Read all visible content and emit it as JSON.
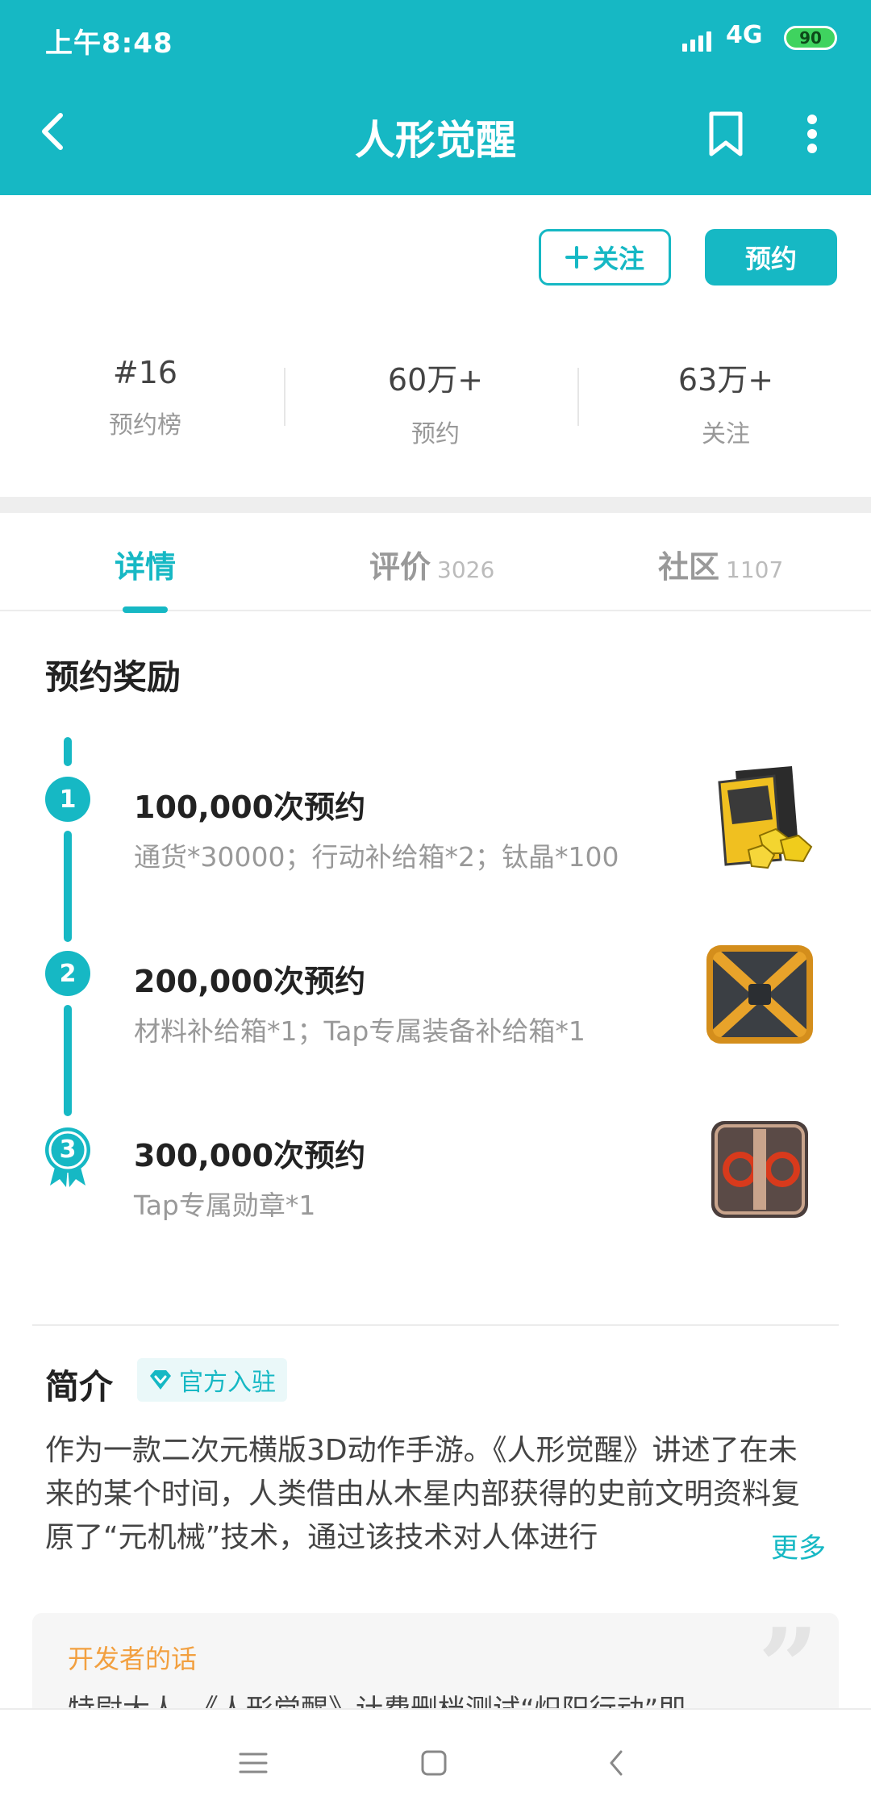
{
  "status_bar": {
    "time": "上午8:48",
    "network": "4G",
    "battery": "90"
  },
  "app_bar": {
    "title": "人形觉醒",
    "icons": [
      "back-arrow-icon",
      "bookmark-icon",
      "more-vertical-icon"
    ]
  },
  "actions": {
    "follow_label": "关注",
    "reserve_label": "预约"
  },
  "stats": [
    {
      "value": "#16",
      "label": "预约榜"
    },
    {
      "value": "60万+",
      "label": "预约"
    },
    {
      "value": "63万+",
      "label": "关注"
    }
  ],
  "tabs": [
    {
      "label": "详情",
      "count": ""
    },
    {
      "label": "评价",
      "count": "3026"
    },
    {
      "label": "社区",
      "count": "1107"
    }
  ],
  "rewards": {
    "title": "预约奖励",
    "items": [
      {
        "step": "1",
        "title": "100,000次预约",
        "desc": "通货*30000；行动补给箱*2；钛晶*100"
      },
      {
        "step": "2",
        "title": "200,000次预约",
        "desc": "材料补给箱*1；Tap专属装备补给箱*1"
      },
      {
        "step": "3",
        "title": "300,000次预约",
        "desc": "Tap专属勋章*1"
      }
    ]
  },
  "intro": {
    "title": "简介",
    "badge": "官方入驻",
    "text": "作为一款二次元横版3D动作手游。《人形觉醒》讲述了在未来的某个时间，人类借由从木星内部获得的史前文明资料复原了“元机械”技术，通过该技术对人体进行",
    "more": "更多"
  },
  "developer": {
    "title": "开发者的话",
    "text": "特尉大人，《人形觉醒》计费删档测试“炽阳行动”即"
  },
  "colors": {
    "accent": "#16b8c4",
    "dev_title": "#f2a040"
  }
}
